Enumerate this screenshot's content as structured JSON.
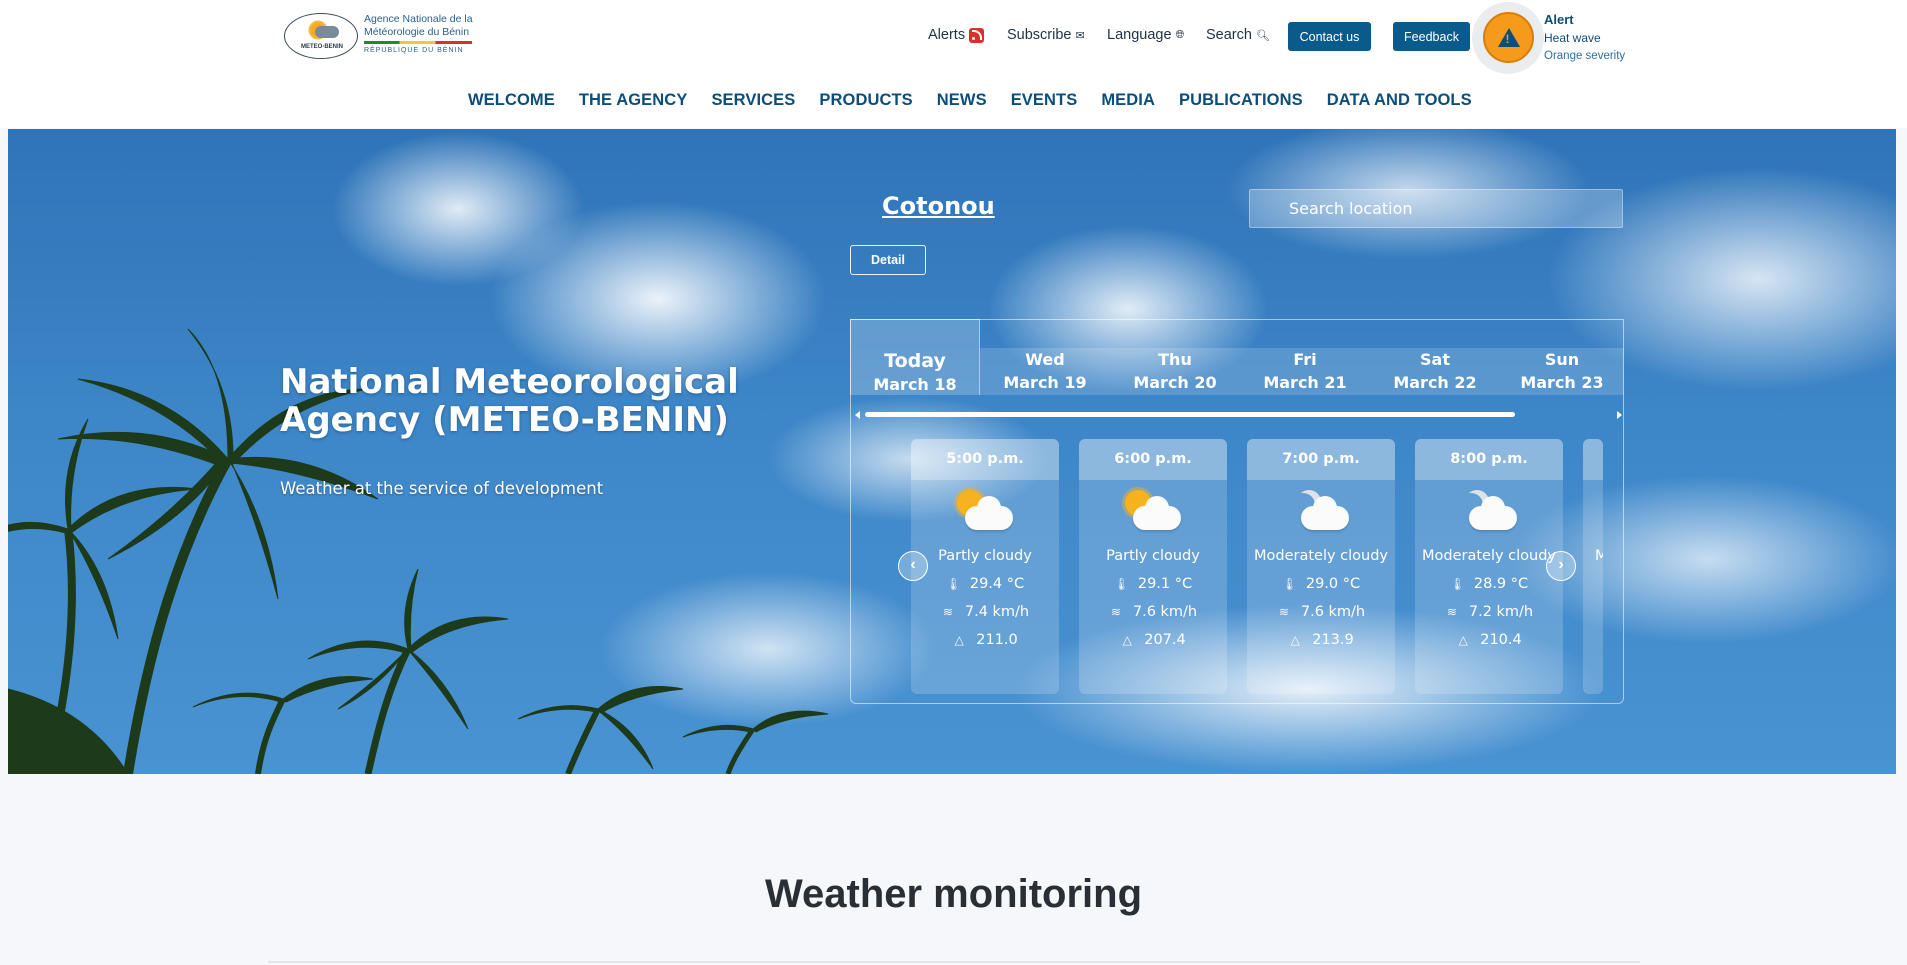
{
  "header": {
    "logo": {
      "seal_text": "METEO-BENIN",
      "line1": "Agence Nationale de la",
      "line2": "Météorologie du Bénin",
      "sub": "RÉPUBLIQUE DU BÉNIN"
    },
    "util": {
      "alerts": "Alerts",
      "subscribe": "Subscribe",
      "language": "Language",
      "search": "Search",
      "contact": "Contact us",
      "feedback": "Feedback"
    },
    "alert": {
      "title": "Alert",
      "type": "Heat wave",
      "severity": "Orange severity",
      "color": "#f59a1b"
    }
  },
  "nav": [
    "WELCOME",
    "THE AGENCY",
    "SERVICES",
    "PRODUCTS",
    "NEWS",
    "EVENTS",
    "MEDIA",
    "PUBLICATIONS",
    "DATA AND TOOLS"
  ],
  "hero": {
    "title": "National Meteorological Agency (METEO-BENIN)",
    "subtitle": "Weather at the service of development",
    "city": "Cotonou",
    "search_placeholder": "Search location",
    "detail": "Detail"
  },
  "forecast": {
    "tabs": [
      {
        "day": "Today",
        "date": "March 18"
      },
      {
        "day": "Wed",
        "date": "March 19"
      },
      {
        "day": "Thu",
        "date": "March 20"
      },
      {
        "day": "Fri",
        "date": "March 21"
      },
      {
        "day": "Sat",
        "date": "March 22"
      },
      {
        "day": "Sun",
        "date": "March 23"
      }
    ],
    "hours": [
      {
        "time": "5:00 p.m.",
        "icon": "partly-cloudy-day-icon",
        "condition": "Partly cloudy",
        "temp": "29.4 °C",
        "wind": "7.4 km/h",
        "pressure": "211.0"
      },
      {
        "time": "6:00 p.m.",
        "icon": "partly-cloudy-day-icon",
        "condition": "Partly cloudy",
        "temp": "29.1 °C",
        "wind": "7.6 km/h",
        "pressure": "207.4"
      },
      {
        "time": "7:00 p.m.",
        "icon": "cloudy-night-icon",
        "condition": "Moderately cloudy",
        "temp": "29.0 °C",
        "wind": "7.6 km/h",
        "pressure": "213.9"
      },
      {
        "time": "8:00 p.m.",
        "icon": "cloudy-night-icon",
        "condition": "Moderately cloudy",
        "temp": "28.9 °C",
        "wind": "7.2 km/h",
        "pressure": "210.4"
      }
    ],
    "partial_card_text": "M"
  },
  "section": {
    "title": "Weather monitoring"
  }
}
